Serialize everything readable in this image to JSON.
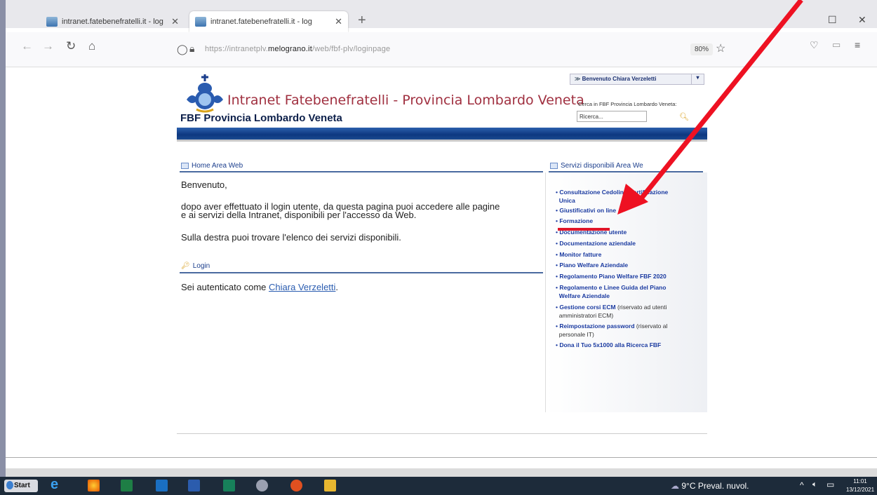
{
  "browser": {
    "tabs": [
      {
        "label": "intranet.fatebenefratelli.it - log"
      },
      {
        "label": "intranet.fatebenefratelli.it - log"
      }
    ],
    "url_prefix": "https://intranetplv.",
    "url_host": "melograno.it",
    "url_path": "/web/fbf-plv/loginpage",
    "zoom": "80%"
  },
  "header": {
    "site_title": "Intranet Fatebenefratelli - Provincia Lombardo Veneta",
    "subtitle": "FBF Provincia Lombardo Veneta",
    "welcome": "Benvenuto Chiara Verzeletti",
    "search_label": "Cerca in FBF Provincia Lombardo Veneta:",
    "search_placeholder": "Ricerca..."
  },
  "home": {
    "heading": "Home Area Web",
    "greeting": "Benvenuto,",
    "para1_line1": "dopo aver effettuato il login utente, da questa pagina puoi accedere alle pagine",
    "para1_line2": "e ai servizi della Intranet, disponibili per l'accesso da Web.",
    "para2": "Sulla destra puoi trovare l'elenco dei servizi disponibili."
  },
  "login": {
    "heading": "Login",
    "text": "Sei autenticato come ",
    "user": "Chiara Verzeletti",
    "dot": "."
  },
  "services": {
    "heading": "Servizi disponibili Area We",
    "items": [
      {
        "label": "Consultazione Cedolino Certificazione",
        "label2": "Unica"
      },
      {
        "label": "Giustificativi on line"
      },
      {
        "label": "Formazione"
      },
      {
        "label": "Documentazione utente"
      },
      {
        "label": "Documentazione aziendale"
      },
      {
        "label": "Monitor fatture"
      },
      {
        "label": "Piano Welfare Aziendale"
      },
      {
        "label": "Regolamento Piano Welfare FBF 2020"
      },
      {
        "label": "Regolamento e Linee Guida del Piano",
        "label2": "Welfare Aziendale"
      },
      {
        "label": "Gestione corsi ECM",
        "note": " (riservato ad utenti",
        "note2": "amministratori ECM)"
      },
      {
        "label": "Reimpostazione password",
        "note": " (riservato al",
        "note2": "personale IT)"
      },
      {
        "label": "Dona il Tuo 5x1000 alla Ricerca FBF"
      }
    ]
  },
  "taskbar": {
    "start": "Start",
    "weather": "9°C  Preval. nuvol.",
    "time": "11:01",
    "date": "13/12/2021"
  }
}
